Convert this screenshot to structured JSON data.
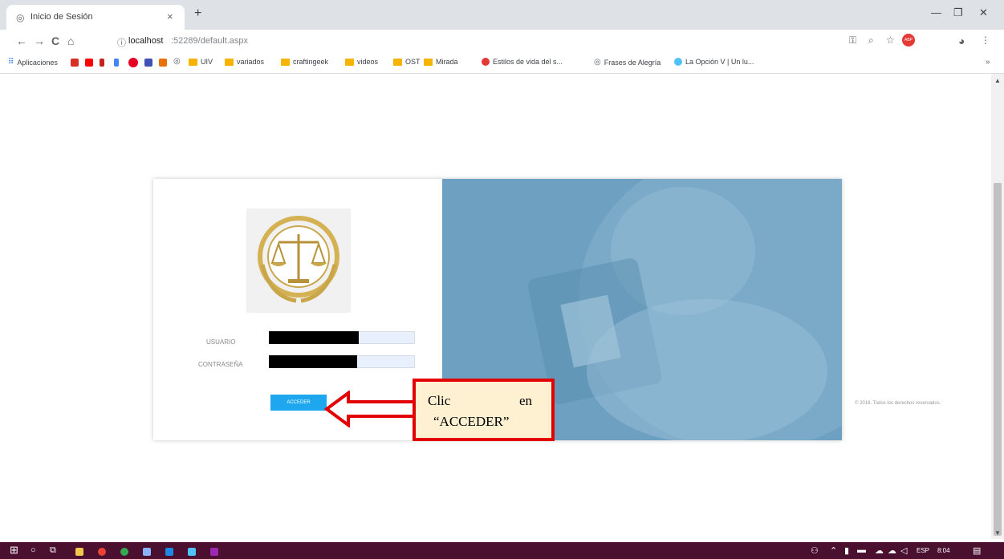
{
  "browser": {
    "tab_title": "Inicio de Sesión",
    "tab_close": "×",
    "new_tab": "+",
    "minimize": "—",
    "restore": "❐",
    "close": "✕",
    "back": "←",
    "forward": "→",
    "reload": "C",
    "home": "⌂",
    "info": "ⓘ",
    "url_host": "localhost",
    "url_path": ":52289/default.aspx",
    "key": "⚿",
    "zoom": "⌕",
    "star": "☆",
    "extension": "ABP",
    "profile": "◕",
    "menu": "⋮"
  },
  "bookmarks": {
    "apps": "Aplicaciones",
    "items": [
      "UIV",
      "variados",
      "craftingeek",
      "videos",
      "OST",
      "Mirada",
      "Estilos de vida del s...",
      "Frases de Alegría",
      "La Opción V | Un lu..."
    ],
    "overflow": "»"
  },
  "login": {
    "user_label": "USUARIO",
    "pass_label": "CONTRASEÑA",
    "submit": "ACCEDER",
    "footer": "© 2018. Todos los derechos reservados."
  },
  "annotation": {
    "line1a": "Clic",
    "line1b": "en",
    "line2": "“ACCEDER”",
    "colors": {
      "border": "#e20000",
      "fill": "#fdf1d2",
      "arrow_fill": "#ffffff"
    }
  },
  "taskbar": {
    "start": "⊞",
    "search": "○",
    "lang": "ESP",
    "time": "8:04"
  }
}
